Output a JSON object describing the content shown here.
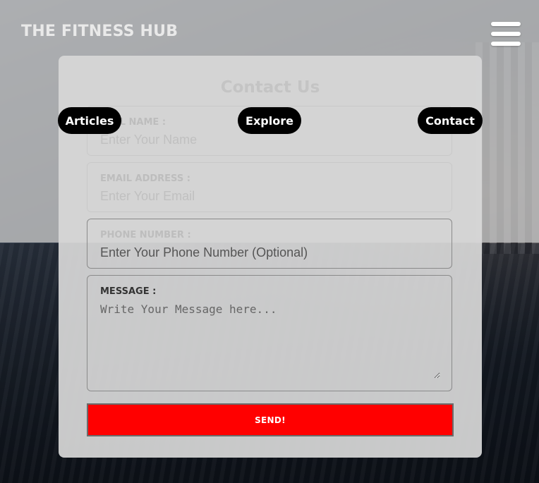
{
  "header": {
    "brand": "THE FITNESS HUB",
    "menu_icon": "hamburger-menu-icon"
  },
  "nav": {
    "items": [
      {
        "label": "Articles"
      },
      {
        "label": "Explore"
      },
      {
        "label": "Contact"
      }
    ]
  },
  "form": {
    "title": "Contact Us",
    "fields": {
      "name": {
        "label": "FULL NAME :",
        "placeholder": "Enter Your Name",
        "value": ""
      },
      "email": {
        "label": "EMAIL ADDRESS :",
        "placeholder": "Enter Your Email",
        "value": ""
      },
      "phone": {
        "label": "PHONE NUMBER :",
        "placeholder": "Enter Your Phone Number (Optional)",
        "value": ""
      },
      "message": {
        "label": "MESSAGE :",
        "placeholder": "Write Your Message here...",
        "value": ""
      }
    },
    "submit_label": "SEND!"
  },
  "colors": {
    "accent": "#ff0000",
    "nav_pill": "#000000",
    "overlay": "#bebebe"
  }
}
